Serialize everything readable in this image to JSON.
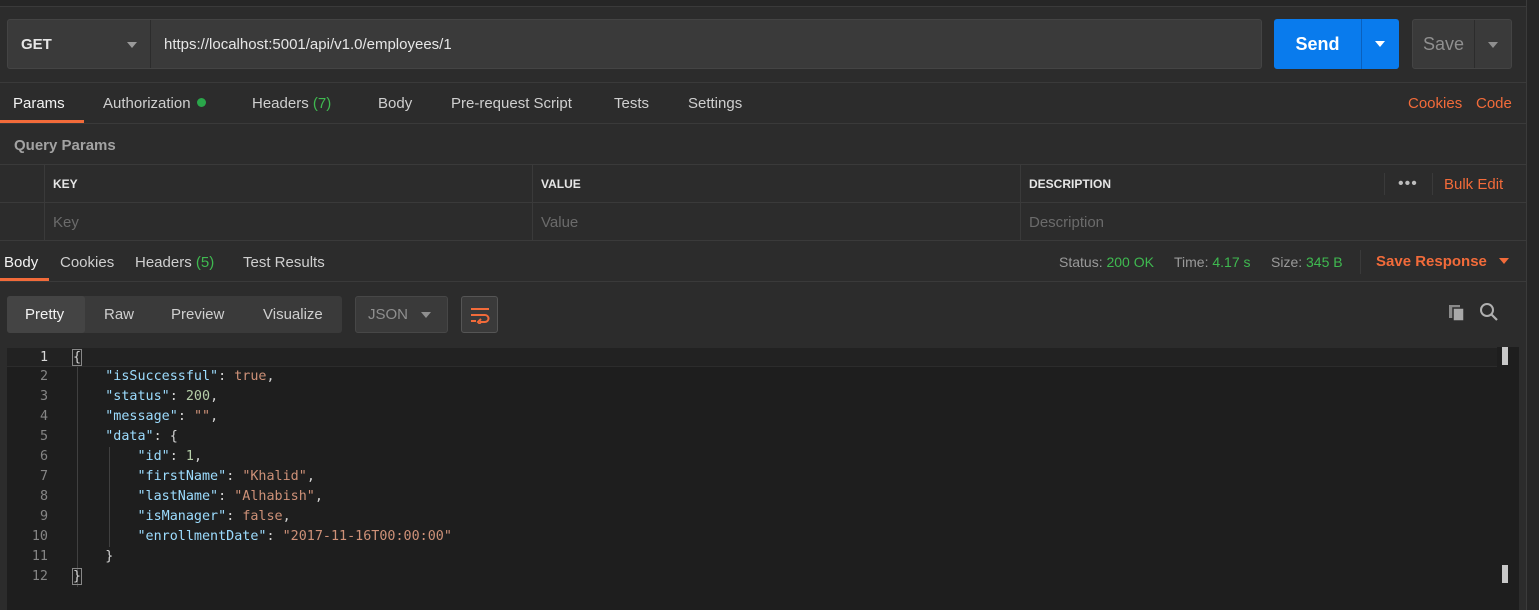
{
  "request": {
    "method": "GET",
    "url": "https://localhost:5001/api/v1.0/employees/1",
    "send_label": "Send",
    "save_label": "Save"
  },
  "request_tabs": {
    "params": "Params",
    "authorization": "Authorization",
    "headers": "Headers",
    "headers_count": "(7)",
    "body": "Body",
    "prerequest": "Pre-request Script",
    "tests": "Tests",
    "settings": "Settings",
    "cookies": "Cookies",
    "code": "Code"
  },
  "query_params": {
    "title": "Query Params",
    "columns": [
      "KEY",
      "VALUE",
      "DESCRIPTION"
    ],
    "placeholders": [
      "Key",
      "Value",
      "Description"
    ],
    "bulk_edit": "Bulk Edit",
    "more": "•••"
  },
  "response_tabs": {
    "body": "Body",
    "cookies": "Cookies",
    "headers": "Headers",
    "headers_count": "(5)",
    "test_results": "Test Results",
    "status_label": "Status:",
    "status_value": "200 OK",
    "time_label": "Time:",
    "time_value": "4.17 s",
    "size_label": "Size:",
    "size_value": "345 B",
    "save_response": "Save Response"
  },
  "response_toolbar": {
    "formats": [
      "Pretty",
      "Raw",
      "Preview",
      "Visualize"
    ],
    "language": "JSON"
  },
  "response_body": {
    "line_numbers": [
      "1",
      "2",
      "3",
      "4",
      "5",
      "6",
      "7",
      "8",
      "9",
      "10",
      "11",
      "12"
    ],
    "isSuccessful": "true",
    "status": "200",
    "message": "\"\"",
    "id": "1",
    "firstName": "\"Khalid\"",
    "lastName": "\"Alhabish\"",
    "isManager": "false",
    "enrollmentDate": "\"2017-11-16T00:00:00\""
  },
  "colors": {
    "accent": "#f26b3a",
    "send_blue": "#097bed",
    "status_green": "#3fb950"
  }
}
